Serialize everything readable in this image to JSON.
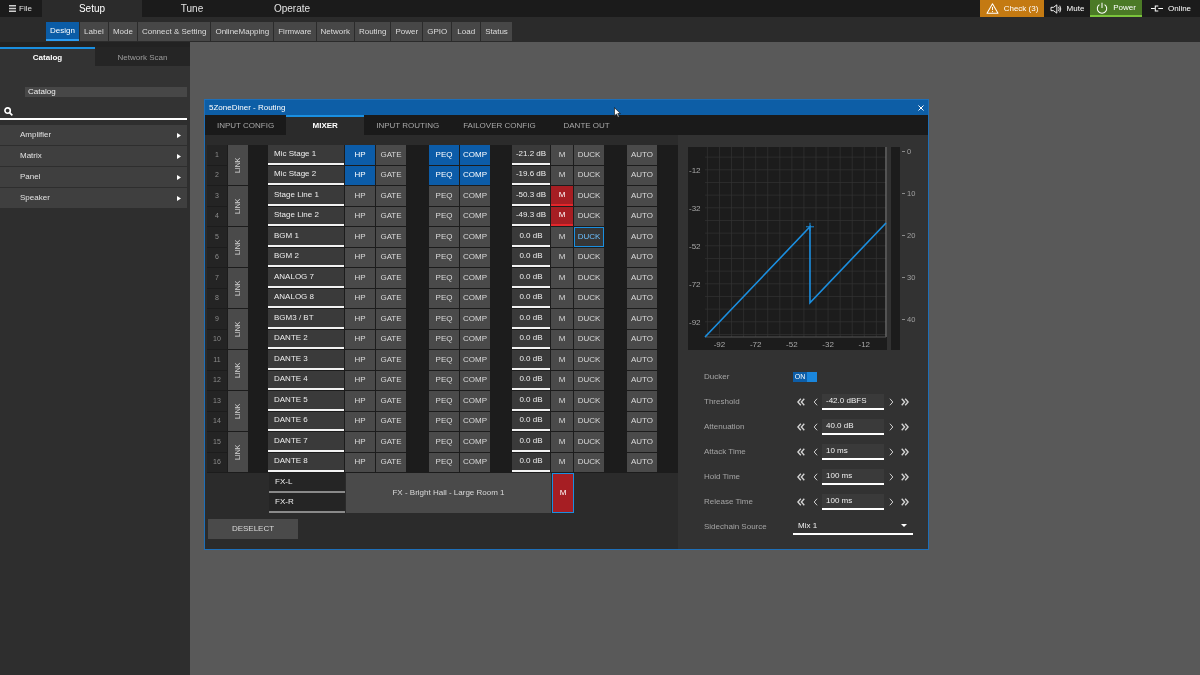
{
  "menu": {
    "label": "File"
  },
  "main_tabs": [
    {
      "label": "Setup",
      "selected": true
    },
    {
      "label": "Tune",
      "selected": false
    },
    {
      "label": "Operate",
      "selected": false
    }
  ],
  "status_buttons": [
    {
      "kind": "check",
      "label": "Check (3)"
    },
    {
      "kind": "mute",
      "label": "Mute"
    },
    {
      "kind": "power",
      "label": "Power"
    },
    {
      "kind": "online",
      "label": "Online"
    }
  ],
  "sub_tabs": [
    {
      "label": "Design",
      "selected": true
    },
    {
      "label": "Label",
      "selected": false
    },
    {
      "label": "Mode",
      "selected": false
    },
    {
      "label": "Connect & Setting",
      "selected": false
    },
    {
      "label": "OnlineMapping",
      "selected": false
    },
    {
      "label": "Firmware",
      "selected": false
    },
    {
      "label": "Network",
      "selected": false
    },
    {
      "label": "Routing",
      "selected": false
    },
    {
      "label": "Power",
      "selected": false
    },
    {
      "label": "GPIO",
      "selected": false
    },
    {
      "label": "Load",
      "selected": false
    },
    {
      "label": "Status",
      "selected": false
    }
  ],
  "sidebar": {
    "tabs": [
      {
        "label": "Catalog",
        "selected": true
      },
      {
        "label": "Network Scan",
        "selected": false
      }
    ],
    "heading": "Catalog",
    "items": [
      {
        "label": "Amplifier",
        "expanded": false
      },
      {
        "label": "Matrix",
        "expanded": false
      },
      {
        "label": "Panel",
        "expanded": false
      },
      {
        "label": "Speaker",
        "expanded": false
      }
    ]
  },
  "dialog": {
    "title": "5ZoneDiner - Routing",
    "tabs": [
      {
        "label": "INPUT CONFIG",
        "selected": false
      },
      {
        "label": "MIXER",
        "selected": true
      },
      {
        "label": "INPUT ROUTING",
        "selected": false
      },
      {
        "label": "FAILOVER CONFIG",
        "selected": false
      },
      {
        "label": "DANTE OUT",
        "selected": false
      }
    ],
    "channel_pairs": [
      {
        "link": "LINK",
        "channels": [
          {
            "number": "1",
            "name": "Mic Stage 1",
            "hp": {
              "label": "HP",
              "on": true
            },
            "gate": {
              "label": "GATE",
              "on": false
            },
            "peq": {
              "label": "PEQ",
              "on": true
            },
            "comp": {
              "label": "COMP",
              "on": true
            },
            "gain": "-21.2 dB",
            "mute": {
              "label": "M",
              "muted": false
            },
            "duck": {
              "label": "DUCK",
              "selected": false
            },
            "auto": "AUTO"
          },
          {
            "number": "2",
            "name": "Mic Stage 2",
            "hp": {
              "label": "HP",
              "on": true
            },
            "gate": {
              "label": "GATE",
              "on": false
            },
            "peq": {
              "label": "PEQ",
              "on": true
            },
            "comp": {
              "label": "COMP",
              "on": true
            },
            "gain": "-19.6 dB",
            "mute": {
              "label": "M",
              "muted": false
            },
            "duck": {
              "label": "DUCK",
              "selected": false
            },
            "auto": "AUTO"
          }
        ]
      },
      {
        "link": "LINK",
        "channels": [
          {
            "number": "3",
            "name": "Stage Line 1",
            "hp": {
              "label": "HP",
              "on": false
            },
            "gate": {
              "label": "GATE",
              "on": false
            },
            "peq": {
              "label": "PEQ",
              "on": false
            },
            "comp": {
              "label": "COMP",
              "on": false
            },
            "gain": "-50.3 dB",
            "mute": {
              "label": "M",
              "muted": true
            },
            "duck": {
              "label": "DUCK",
              "selected": false
            },
            "auto": "AUTO"
          },
          {
            "number": "4",
            "name": "Stage Line 2",
            "hp": {
              "label": "HP",
              "on": false
            },
            "gate": {
              "label": "GATE",
              "on": false
            },
            "peq": {
              "label": "PEQ",
              "on": false
            },
            "comp": {
              "label": "COMP",
              "on": false
            },
            "gain": "-49.3 dB",
            "mute": {
              "label": "M",
              "muted": true
            },
            "duck": {
              "label": "DUCK",
              "selected": false
            },
            "auto": "AUTO"
          }
        ]
      },
      {
        "link": "LINK",
        "channels": [
          {
            "number": "5",
            "name": "BGM 1",
            "hp": {
              "label": "HP",
              "on": false
            },
            "gate": {
              "label": "GATE",
              "on": false
            },
            "peq": {
              "label": "PEQ",
              "on": false
            },
            "comp": {
              "label": "COMP",
              "on": false
            },
            "gain": "0.0 dB",
            "mute": {
              "label": "M",
              "muted": false
            },
            "duck": {
              "label": "DUCK",
              "selected": true
            },
            "auto": "AUTO"
          },
          {
            "number": "6",
            "name": "BGM 2",
            "hp": {
              "label": "HP",
              "on": false
            },
            "gate": {
              "label": "GATE",
              "on": false
            },
            "peq": {
              "label": "PEQ",
              "on": false
            },
            "comp": {
              "label": "COMP",
              "on": false
            },
            "gain": "0.0 dB",
            "mute": {
              "label": "M",
              "muted": false
            },
            "duck": {
              "label": "DUCK",
              "selected": false
            },
            "auto": "AUTO"
          }
        ]
      },
      {
        "link": "LINK",
        "channels": [
          {
            "number": "7",
            "name": "ANALOG 7",
            "hp": {
              "label": "HP",
              "on": false
            },
            "gate": {
              "label": "GATE",
              "on": false
            },
            "peq": {
              "label": "PEQ",
              "on": false
            },
            "comp": {
              "label": "COMP",
              "on": false
            },
            "gain": "0.0 dB",
            "mute": {
              "label": "M",
              "muted": false
            },
            "duck": {
              "label": "DUCK",
              "selected": false
            },
            "auto": "AUTO"
          },
          {
            "number": "8",
            "name": "ANALOG 8",
            "hp": {
              "label": "HP",
              "on": false
            },
            "gate": {
              "label": "GATE",
              "on": false
            },
            "peq": {
              "label": "PEQ",
              "on": false
            },
            "comp": {
              "label": "COMP",
              "on": false
            },
            "gain": "0.0 dB",
            "mute": {
              "label": "M",
              "muted": false
            },
            "duck": {
              "label": "DUCK",
              "selected": false
            },
            "auto": "AUTO"
          }
        ]
      },
      {
        "link": "LINK",
        "channels": [
          {
            "number": "9",
            "name": "BGM3 / BT",
            "hp": {
              "label": "HP",
              "on": false
            },
            "gate": {
              "label": "GATE",
              "on": false
            },
            "peq": {
              "label": "PEQ",
              "on": false
            },
            "comp": {
              "label": "COMP",
              "on": false
            },
            "gain": "0.0 dB",
            "mute": {
              "label": "M",
              "muted": false
            },
            "duck": {
              "label": "DUCK",
              "selected": false
            },
            "auto": "AUTO"
          },
          {
            "number": "10",
            "name": "DANTE 2",
            "hp": {
              "label": "HP",
              "on": false
            },
            "gate": {
              "label": "GATE",
              "on": false
            },
            "peq": {
              "label": "PEQ",
              "on": false
            },
            "comp": {
              "label": "COMP",
              "on": false
            },
            "gain": "0.0 dB",
            "mute": {
              "label": "M",
              "muted": false
            },
            "duck": {
              "label": "DUCK",
              "selected": false
            },
            "auto": "AUTO"
          }
        ]
      },
      {
        "link": "LINK",
        "channels": [
          {
            "number": "11",
            "name": "DANTE 3",
            "hp": {
              "label": "HP",
              "on": false
            },
            "gate": {
              "label": "GATE",
              "on": false
            },
            "peq": {
              "label": "PEQ",
              "on": false
            },
            "comp": {
              "label": "COMP",
              "on": false
            },
            "gain": "0.0 dB",
            "mute": {
              "label": "M",
              "muted": false
            },
            "duck": {
              "label": "DUCK",
              "selected": false
            },
            "auto": "AUTO"
          },
          {
            "number": "12",
            "name": "DANTE 4",
            "hp": {
              "label": "HP",
              "on": false
            },
            "gate": {
              "label": "GATE",
              "on": false
            },
            "peq": {
              "label": "PEQ",
              "on": false
            },
            "comp": {
              "label": "COMP",
              "on": false
            },
            "gain": "0.0 dB",
            "mute": {
              "label": "M",
              "muted": false
            },
            "duck": {
              "label": "DUCK",
              "selected": false
            },
            "auto": "AUTO"
          }
        ]
      },
      {
        "link": "LINK",
        "channels": [
          {
            "number": "13",
            "name": "DANTE 5",
            "hp": {
              "label": "HP",
              "on": false
            },
            "gate": {
              "label": "GATE",
              "on": false
            },
            "peq": {
              "label": "PEQ",
              "on": false
            },
            "comp": {
              "label": "COMP",
              "on": false
            },
            "gain": "0.0 dB",
            "mute": {
              "label": "M",
              "muted": false
            },
            "duck": {
              "label": "DUCK",
              "selected": false
            },
            "auto": "AUTO"
          },
          {
            "number": "14",
            "name": "DANTE 6",
            "hp": {
              "label": "HP",
              "on": false
            },
            "gate": {
              "label": "GATE",
              "on": false
            },
            "peq": {
              "label": "PEQ",
              "on": false
            },
            "comp": {
              "label": "COMP",
              "on": false
            },
            "gain": "0.0 dB",
            "mute": {
              "label": "M",
              "muted": false
            },
            "duck": {
              "label": "DUCK",
              "selected": false
            },
            "auto": "AUTO"
          }
        ]
      },
      {
        "link": "LINK",
        "channels": [
          {
            "number": "15",
            "name": "DANTE 7",
            "hp": {
              "label": "HP",
              "on": false
            },
            "gate": {
              "label": "GATE",
              "on": false
            },
            "peq": {
              "label": "PEQ",
              "on": false
            },
            "comp": {
              "label": "COMP",
              "on": false
            },
            "gain": "0.0 dB",
            "mute": {
              "label": "M",
              "muted": false
            },
            "duck": {
              "label": "DUCK",
              "selected": false
            },
            "auto": "AUTO"
          },
          {
            "number": "16",
            "name": "DANTE 8",
            "hp": {
              "label": "HP",
              "on": false
            },
            "gate": {
              "label": "GATE",
              "on": false
            },
            "peq": {
              "label": "PEQ",
              "on": false
            },
            "comp": {
              "label": "COMP",
              "on": false
            },
            "gain": "0.0 dB",
            "mute": {
              "label": "M",
              "muted": false
            },
            "duck": {
              "label": "DUCK",
              "selected": false
            },
            "auto": "AUTO"
          }
        ]
      }
    ],
    "fx": {
      "channels": [
        "FX-L",
        "FX-R"
      ],
      "effect": "FX - Bright Hall - Large Room 1",
      "mute": {
        "label": "M",
        "muted": true,
        "selected": true
      }
    },
    "deselect": "DESELECT",
    "ducker_panel": {
      "chart_data": {
        "type": "line",
        "x": [
          -100,
          -42,
          -42,
          0
        ],
        "values": [
          -100,
          -42,
          -82,
          -40
        ],
        "xlim": [
          -100,
          0
        ],
        "ylim": [
          -100,
          0
        ],
        "xticks": [
          -92,
          -72,
          -52,
          -32,
          -12
        ],
        "yticks": [
          -12,
          -32,
          -52,
          -72,
          -92
        ],
        "grid": true
      },
      "meter_ticks": [
        "0",
        "10",
        "20",
        "30",
        "40"
      ],
      "ducker": {
        "label": "Ducker",
        "on": true,
        "switch_text": "ON"
      },
      "parameters": [
        {
          "label": "Threshold",
          "value": "-42.0 dBFS"
        },
        {
          "label": "Attenuation",
          "value": "40.0 dB"
        },
        {
          "label": "Attack Time",
          "value": "10 ms"
        },
        {
          "label": "Hold Time",
          "value": "100 ms"
        },
        {
          "label": "Release Time",
          "value": "100 ms"
        }
      ],
      "sidechain": {
        "label": "Sidechain Source",
        "value": "Mix 1"
      }
    }
  }
}
